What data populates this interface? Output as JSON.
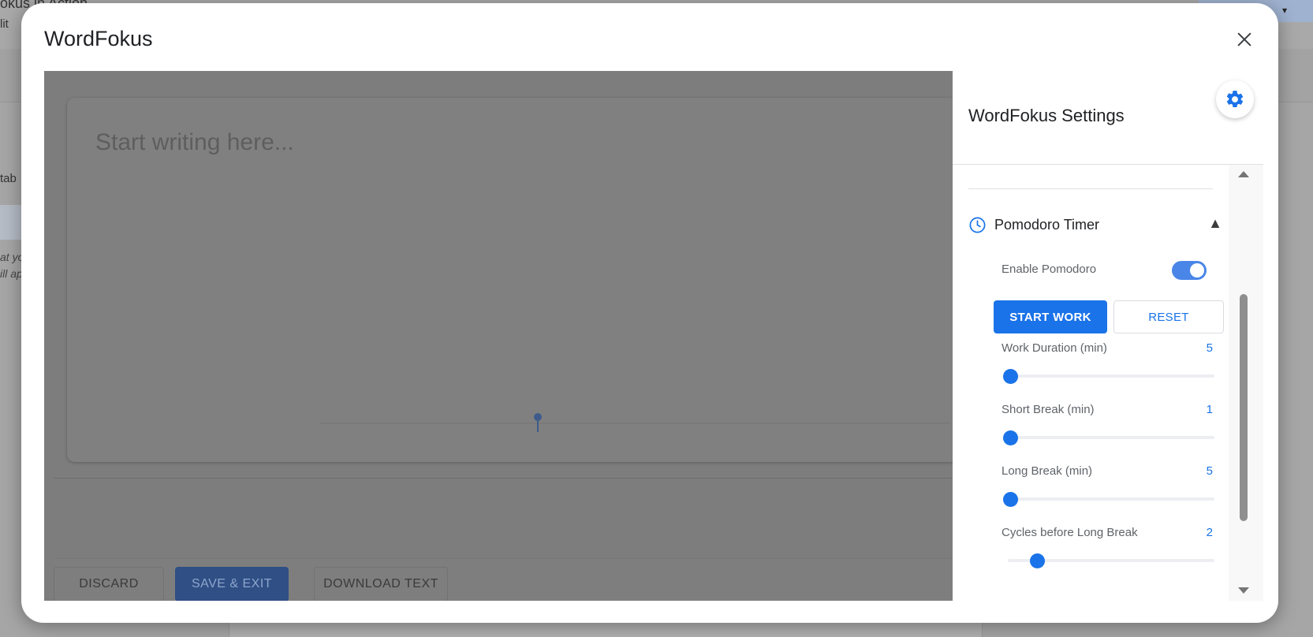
{
  "background": {
    "doc_title": "okus in Action",
    "menu_text": "lit",
    "tab_text": "tab",
    "hint_lines": [
      "at yo",
      "ill ap"
    ]
  },
  "modal": {
    "title": "WordFokus",
    "close_icon": "close-icon"
  },
  "editor": {
    "placeholder": "Start writing here...",
    "footer": {
      "discard_label": "DISCARD",
      "save_label": "SAVE & EXIT",
      "download_label": "DOWNLOAD TEXT"
    }
  },
  "settings": {
    "title": "WordFokus Settings",
    "gear_icon": "gear-icon",
    "pomodoro": {
      "section_label": "Pomodoro Timer",
      "caret": "▲",
      "enable_label": "Enable Pomodoro",
      "enabled": true,
      "start_label": "START WORK",
      "reset_label": "RESET",
      "sliders": [
        {
          "label": "Work Duration (min)",
          "value": "5"
        },
        {
          "label": "Short Break (min)",
          "value": "1"
        },
        {
          "label": "Long Break (min)",
          "value": "5"
        },
        {
          "label": "Cycles before Long Break",
          "value": "2"
        }
      ]
    }
  },
  "colors": {
    "accent": "#1a73e8",
    "toggle_on": "#4a86e8"
  }
}
